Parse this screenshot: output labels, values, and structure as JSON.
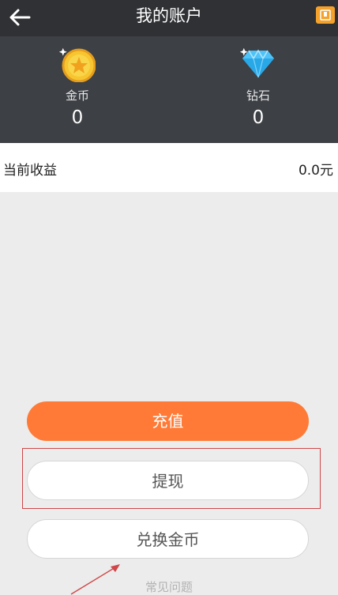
{
  "header": {
    "title": "我的账户"
  },
  "stats": {
    "gold": {
      "label": "金币",
      "value": "0"
    },
    "diamond": {
      "label": "钻石",
      "value": "0"
    }
  },
  "earnings": {
    "label": "当前收益",
    "value": "0.0元"
  },
  "actions": {
    "recharge_label": "充值",
    "withdraw_label": "提现",
    "exchange_label": "兑换金币"
  },
  "faq": {
    "label": "常见问题"
  },
  "icons": {
    "back": "back-arrow-icon",
    "menu": "menu-icon",
    "gold": "gold-coin-icon",
    "diamond": "diamond-icon"
  },
  "colors": {
    "header_bg": "#2f3134",
    "stats_bg": "#3d4045",
    "primary_button": "#ff7a36",
    "menu_badge": "#f4a22b",
    "highlight": "#d0464a"
  }
}
